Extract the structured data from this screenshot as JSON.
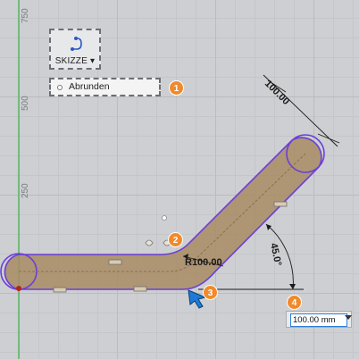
{
  "ruler": {
    "labels": [
      "750",
      "500",
      "250"
    ]
  },
  "toolbar": {
    "sketch_button_label": "SKIZZE",
    "sketch_button_icon": "sketch-curve-icon"
  },
  "context_menu": {
    "fillet_item_label": "Abrunden"
  },
  "callouts": [
    "1",
    "2",
    "3",
    "4"
  ],
  "dimensions": {
    "length": "100.00",
    "radius": "R100.00",
    "angle": "45.0°"
  },
  "input": {
    "value": "100.00 mm"
  },
  "colors": {
    "slot_fill": "#a88b64",
    "slot_outline": "#6a3fd8",
    "callout": "#f08a2c",
    "input_border": "#2f7fd6",
    "axis_green": "#3fb24a"
  }
}
